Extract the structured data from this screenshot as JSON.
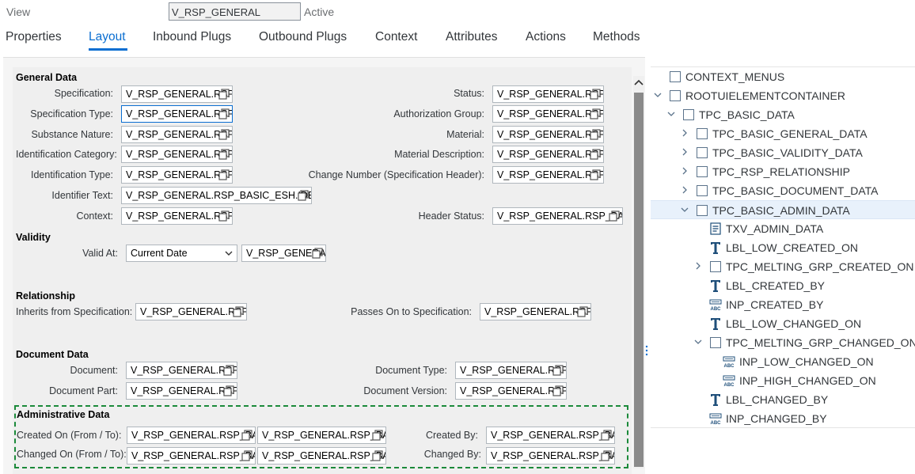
{
  "header": {
    "view_label": "View",
    "view_name": "V_RSP_GENERAL",
    "view_status": "Active"
  },
  "tabs": [
    {
      "label": "Properties",
      "active": false
    },
    {
      "label": "Layout",
      "active": true
    },
    {
      "label": "Inbound Plugs",
      "active": false
    },
    {
      "label": "Outbound Plugs",
      "active": false
    },
    {
      "label": "Context",
      "active": false
    },
    {
      "label": "Attributes",
      "active": false
    },
    {
      "label": "Actions",
      "active": false
    },
    {
      "label": "Methods",
      "active": false
    }
  ],
  "colors": {
    "accent": "#0a6ed1",
    "dashed_border": "#1b8a3a",
    "scroll_thumb": "#8a8a8a"
  },
  "form": {
    "general": {
      "title": "General Data",
      "specification": {
        "label": "Specification:",
        "value": "V_RSP_GENERAL.RSP_BASIC_ESH.SPECIFICATION"
      },
      "specification_type": {
        "label": "Specification Type:",
        "value": "V_RSP_GENERAL.RSP_BASIC_ESH.SPECIFICATION_TYPE"
      },
      "substance_nature": {
        "label": "Substance Nature:",
        "value": "V_RSP_GENERAL.RSP_BASIC_ESH.SUBSTANCE_NATURE"
      },
      "identification_category": {
        "label": "Identification Category:",
        "value": "V_RSP_GENERAL.RSP_BASIC_ESH.IDENT_CATEGORY"
      },
      "identification_type": {
        "label": "Identification Type:",
        "value": "V_RSP_GENERAL.RSP_BASIC_ESH.IDENT_TYPE"
      },
      "identifier_text": {
        "label": "Identifier Text:",
        "value": "V_RSP_GENERAL.RSP_BASIC_ESH.IDENTIFIER"
      },
      "context": {
        "label": "Context:",
        "value": "V_RSP_GENERAL.RSP_BASIC_ESH.CONTEXT"
      },
      "status": {
        "label": "Status:",
        "value": "V_RSP_GENERAL.RSP_BASIC_ESH.STATUS"
      },
      "authorization_group": {
        "label": "Authorization Group:",
        "value": "V_RSP_GENERAL.RSP_BASIC_ESH.AUTH_GROUP"
      },
      "material": {
        "label": "Material:",
        "value": "V_RSP_GENERAL.RSP_BASIC_ESH.MATERIAL"
      },
      "material_description": {
        "label": "Material Description:",
        "value": "V_RSP_GENERAL.RSP_BASIC_ESH.MATERIAL_DESCR"
      },
      "change_number": {
        "label": "Change Number (Specification Header):",
        "value": "V_RSP_GENERAL.RSP_BASIC_ESH.CHANGE_NUMBER"
      },
      "header_status": {
        "label": "Header Status:",
        "value": "V_RSP_GENERAL.RSP_BASIC_ESH.HEADER_STATUS"
      }
    },
    "validity": {
      "title": "Validity",
      "valid_at": {
        "label": "Valid At:",
        "selected": "Current Date",
        "value": "V_RSP_GENERAL.RSP_BASIC_ESH.VALID_AT"
      }
    },
    "relationship": {
      "title": "Relationship",
      "inherits_from": {
        "label": "Inherits from Specification:",
        "value": "V_RSP_GENERAL.RSP_BASIC_ESH.INHERITS_FROM"
      },
      "passes_on_to": {
        "label": "Passes On to Specification:",
        "value": "V_RSP_GENERAL.RSP_BASIC_ESH.PASSES_ON_TO"
      }
    },
    "document": {
      "title": "Document Data",
      "document": {
        "label": "Document:",
        "value": "V_RSP_GENERAL.RSP_BASIC_ESH.DOCUMENT"
      },
      "document_part": {
        "label": "Document Part:",
        "value": "V_RSP_GENERAL.RSP_BASIC_ESH.DOCUMENT_PART"
      },
      "document_type": {
        "label": "Document Type:",
        "value": "V_RSP_GENERAL.RSP_BASIC_ESH.DOCUMENT_TYPE"
      },
      "document_version": {
        "label": "Document Version:",
        "value": "V_RSP_GENERAL.RSP_BASIC_ESH.DOCUMENT_VERSION"
      }
    },
    "admin": {
      "title": "Administrative Data",
      "created_on": {
        "label": "Created On (From / To):",
        "from": "V_RSP_GENERAL.RSP_BASIC_ESH.CREATED_ON_FROM",
        "to": "V_RSP_GENERAL.RSP_BASIC_ESH.CREATED_ON_TO"
      },
      "changed_on": {
        "label": "Changed On (From / To):",
        "from": "V_RSP_GENERAL.RSP_BASIC_ESH.CHANGED_ON_FROM",
        "to": "V_RSP_GENERAL.RSP_BASIC_ESH.CHANGED_ON_TO"
      },
      "created_by": {
        "label": "Created By:",
        "value": "V_RSP_GENERAL.RSP_BASIC_ESH.CREATED_BY"
      },
      "changed_by": {
        "label": "Changed By:",
        "value": "V_RSP_GENERAL.RSP_BASIC_ESH.CHANGED_BY"
      }
    }
  },
  "tree": [
    {
      "label": "CONTEXT_MENUS",
      "icon": "checkbox",
      "expander": "none"
    },
    {
      "label": "ROOTUIELEMENTCONTAINER",
      "icon": "checkbox",
      "expander": "expanded"
    },
    {
      "label": "TPC_BASIC_DATA",
      "icon": "checkbox",
      "expander": "expanded"
    },
    {
      "label": "TPC_BASIC_GENERAL_DATA",
      "icon": "checkbox",
      "expander": "collapsed"
    },
    {
      "label": "TPC_BASIC_VALIDITY_DATA",
      "icon": "checkbox",
      "expander": "collapsed"
    },
    {
      "label": "TPC_RSP_RELATIONSHIP",
      "icon": "checkbox",
      "expander": "collapsed"
    },
    {
      "label": "TPC_BASIC_DOCUMENT_DATA",
      "icon": "checkbox",
      "expander": "collapsed"
    },
    {
      "label": "TPC_BASIC_ADMIN_DATA",
      "icon": "checkbox",
      "expander": "expanded",
      "selected": true
    },
    {
      "label": "TXV_ADMIN_DATA",
      "icon": "textview-icon",
      "expander": "none"
    },
    {
      "label": "LBL_LOW_CREATED_ON",
      "icon": "label-icon",
      "expander": "none"
    },
    {
      "label": "TPC_MELTING_GRP_CREATED_ON",
      "icon": "checkbox",
      "expander": "collapsed"
    },
    {
      "label": "LBL_CREATED_BY",
      "icon": "label-icon",
      "expander": "none"
    },
    {
      "label": "INP_CREATED_BY",
      "icon": "inputfield-icon",
      "expander": "none"
    },
    {
      "label": "LBL_LOW_CHANGED_ON",
      "icon": "label-icon",
      "expander": "none"
    },
    {
      "label": "TPC_MELTING_GRP_CHANGED_ON",
      "icon": "checkbox",
      "expander": "expanded"
    },
    {
      "label": "INP_LOW_CHANGED_ON",
      "icon": "inputfield-icon",
      "expander": "none"
    },
    {
      "label": "INP_HIGH_CHANGED_ON",
      "icon": "inputfield-icon",
      "expander": "none"
    },
    {
      "label": "LBL_CHANGED_BY",
      "icon": "label-icon",
      "expander": "none"
    },
    {
      "label": "INP_CHANGED_BY",
      "icon": "inputfield-icon",
      "expander": "none"
    }
  ]
}
